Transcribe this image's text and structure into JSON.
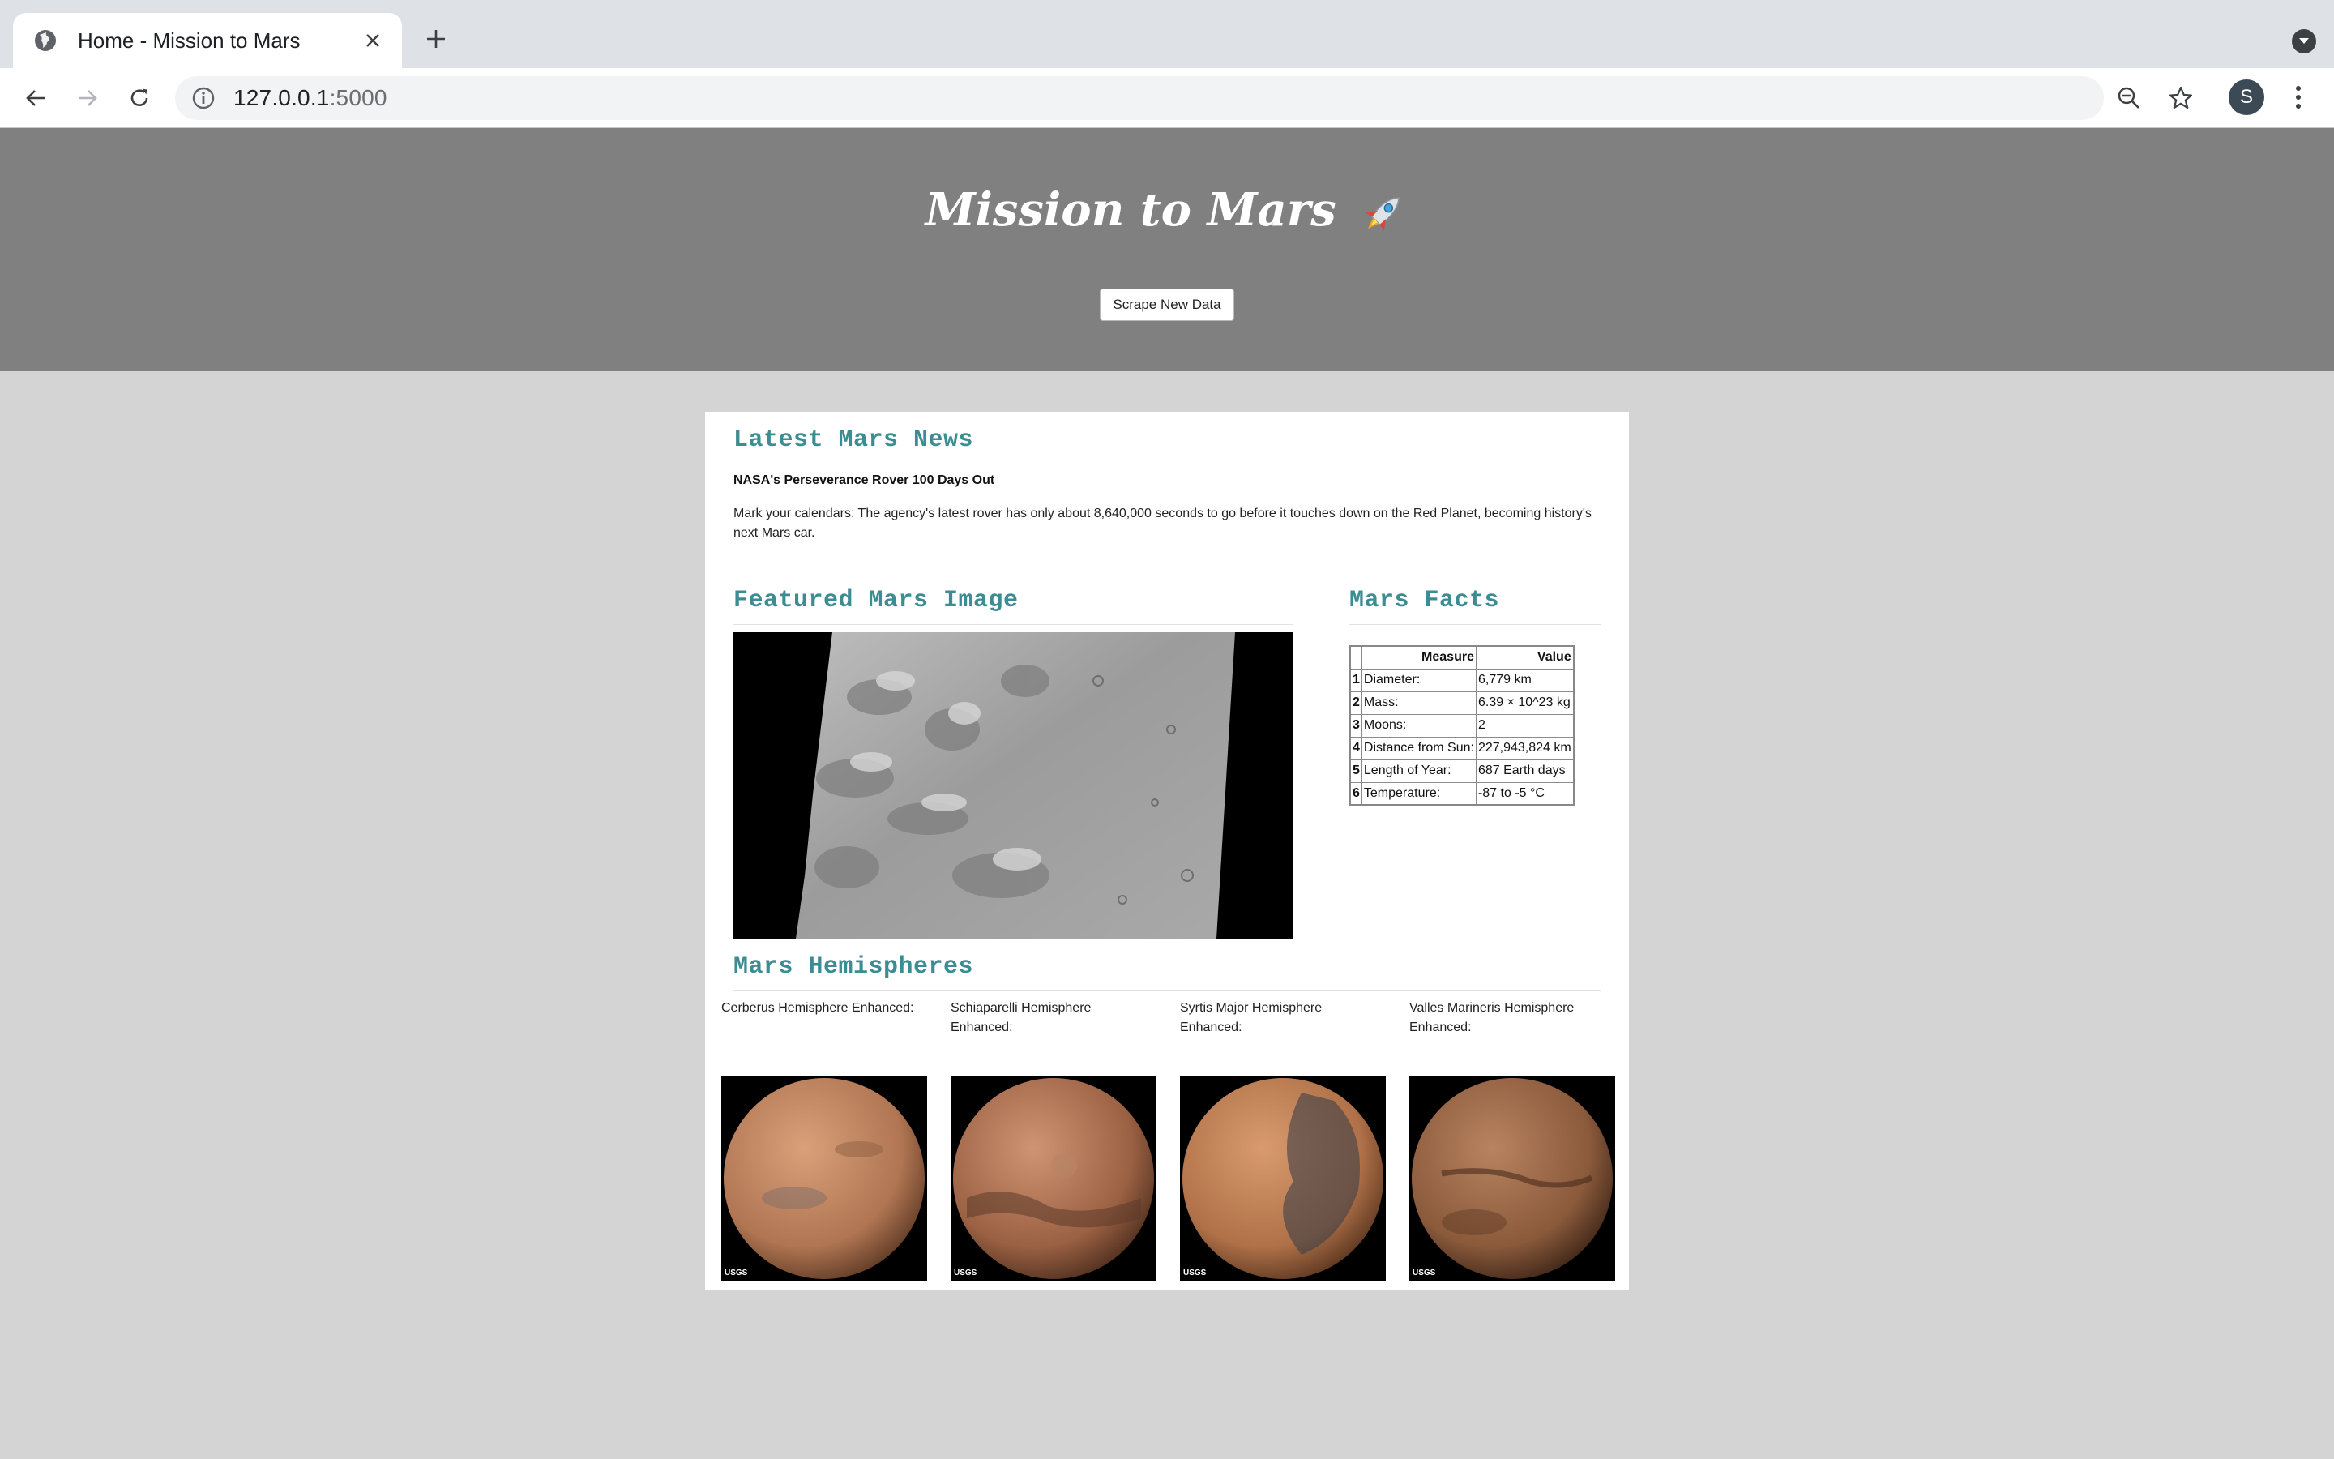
{
  "browser": {
    "tab_title": "Home - Mission to Mars",
    "url_host": "127.0.0.1",
    "url_port": ":5000",
    "profile_initial": "S"
  },
  "header": {
    "title": "Mission to Mars",
    "scrape_button": "Scrape New Data"
  },
  "news": {
    "heading": "Latest Mars News",
    "title": "NASA's Perseverance Rover 100 Days Out",
    "paragraph": "Mark your calendars: The agency's latest rover has only about 8,640,000 seconds to go before it touches down on the Red Planet, becoming history's next Mars car."
  },
  "featured": {
    "heading": "Featured Mars Image"
  },
  "facts": {
    "heading": "Mars Facts",
    "columns": [
      "Measure",
      "Value"
    ],
    "rows": [
      {
        "index": "1",
        "measure": "Diameter:",
        "value": "6,779 km"
      },
      {
        "index": "2",
        "measure": "Mass:",
        "value": "6.39 × 10^23 kg"
      },
      {
        "index": "3",
        "measure": "Moons:",
        "value": "2"
      },
      {
        "index": "4",
        "measure": "Distance from Sun:",
        "value": "227,943,824 km"
      },
      {
        "index": "5",
        "measure": "Length of Year:",
        "value": "687 Earth days"
      },
      {
        "index": "6",
        "measure": "Temperature:",
        "value": "-87 to -5 °C"
      }
    ]
  },
  "hemispheres": {
    "heading": "Mars Hemispheres",
    "items": [
      {
        "title": "Cerberus Hemisphere Enhanced:",
        "logo": "USGS",
        "tint": "#b77a55"
      },
      {
        "title": "Schiaparelli Hemisphere Enhanced:",
        "logo": "USGS",
        "tint": "#a8694a"
      },
      {
        "title": "Syrtis Major Hemisphere Enhanced:",
        "logo": "USGS",
        "tint": "#b8784e"
      },
      {
        "title": "Valles Marineris Hemisphere Enhanced:",
        "logo": "USGS",
        "tint": "#92603f"
      }
    ]
  }
}
